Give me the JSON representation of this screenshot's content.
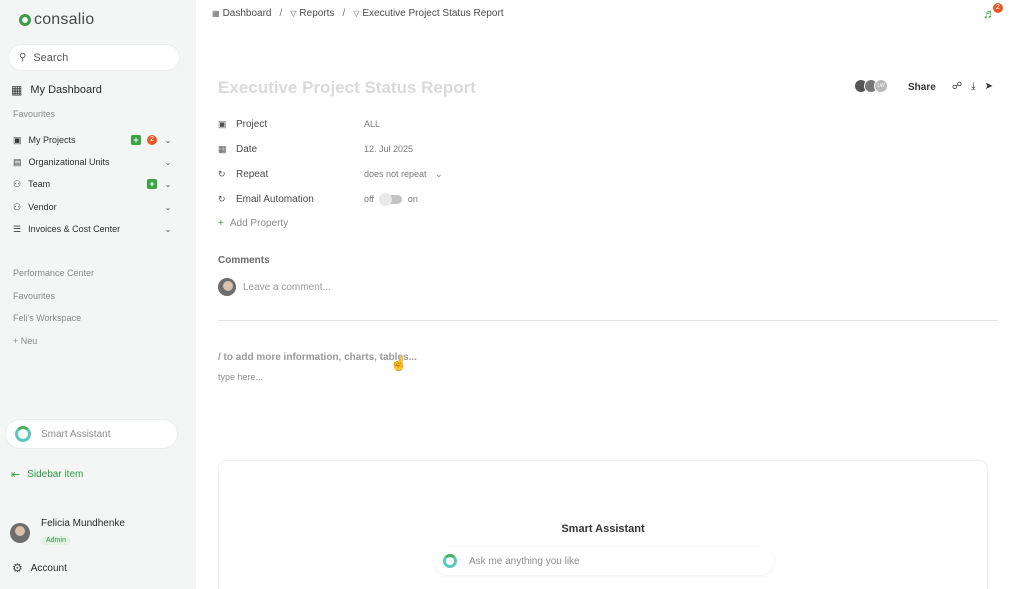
{
  "app": {
    "brand": "consalio",
    "accent": "#3aa346",
    "alert": "#e65a2a"
  },
  "sidebar": {
    "search_placeholder": "Search",
    "dashboard_label": "My Dashboard",
    "favourites_label": "Favourites",
    "items": [
      {
        "label": "My Projects",
        "plus": true,
        "count": "2"
      },
      {
        "label": "Organizational Units",
        "plus": false,
        "count": ""
      },
      {
        "label": "Team",
        "plus": true,
        "count": ""
      },
      {
        "label": "Vendor",
        "plus": false,
        "count": ""
      },
      {
        "label": "Invoices & Cost Center",
        "plus": false,
        "count": ""
      }
    ],
    "links": [
      "Performance Center",
      "Favourites",
      "Feli's Workspace",
      "+ Neu"
    ],
    "assistant_label": "Smart Assistant",
    "sidebar_item_label": "Sidebar item",
    "user": {
      "name": "Felicia Mundhenke",
      "role": "Admin"
    },
    "account_label": "Account"
  },
  "header": {
    "breadcrumbs": [
      "Dashboard",
      "Reports",
      "Executive Project Status Report"
    ],
    "notification_count": "2"
  },
  "report": {
    "title": "Executive Project Status Report",
    "collaborator_initials": "LW",
    "share_label": "Share",
    "properties": {
      "project": {
        "label": "Project",
        "value": "ALL"
      },
      "date": {
        "label": "Date",
        "value": "12. Jul 2025"
      },
      "repeat": {
        "label": "Repeat",
        "value": "does not repeat"
      },
      "email": {
        "label": "Email Automation",
        "off": "off",
        "on": "on"
      }
    },
    "add_property": "Add Property",
    "comments_label": "Comments",
    "comment_placeholder": "Leave a comment...",
    "hint": "/ to add more information, charts, tables...",
    "type_placeholder": "type here...",
    "assistant_panel": {
      "title": "Smart Assistant",
      "placeholder": "Ask me anything you like"
    }
  }
}
